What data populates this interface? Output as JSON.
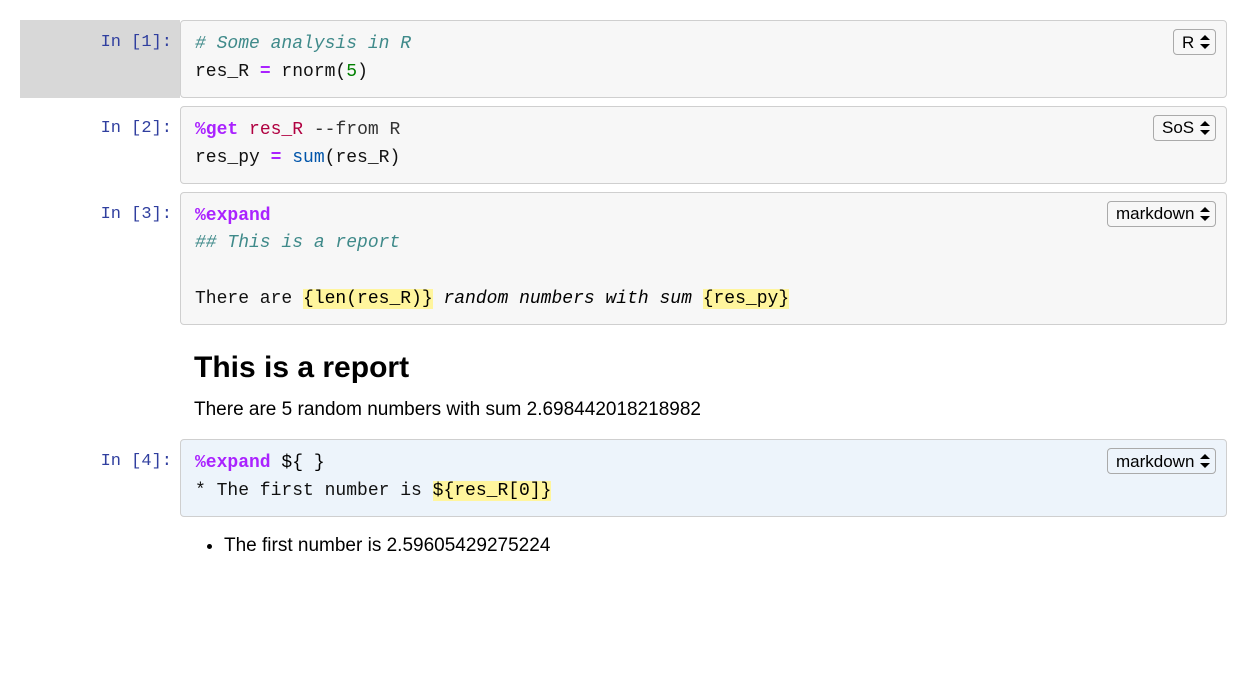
{
  "cells": [
    {
      "prompt": "In [1]:",
      "kernel": "R",
      "selected": true,
      "code": {
        "line1_comment": "# Some analysis in R",
        "line2_a": "res_R ",
        "line2_op": "=",
        "line2_b": " rnorm(",
        "line2_num": "5",
        "line2_c": ")"
      }
    },
    {
      "prompt": "In [2]:",
      "kernel": "SoS",
      "code": {
        "line1_magic": "%get",
        "line1_a": " ",
        "line1_arg": "res_R",
        "line1_b": " ",
        "line1_flag": "--from R",
        "line2_a": "res_py ",
        "line2_op": "=",
        "line2_b": " ",
        "line2_func": "sum",
        "line2_c": "(res_R)"
      }
    },
    {
      "prompt": "In [3]:",
      "kernel": "markdown",
      "code": {
        "line1_magic": "%expand",
        "line2_head": "## This is a report",
        "line4_a": "There are ",
        "line4_hl1": "{len(res_R)}",
        "line4_b": " random numbers with sum ",
        "line4_hl2": "{res_py}"
      },
      "output": {
        "heading": "This is a report",
        "para": "There are 5 random numbers with sum 2.698442018218982"
      }
    },
    {
      "prompt": "In [4]:",
      "kernel": "markdown",
      "blue": true,
      "code": {
        "line1_magic": "%expand",
        "line1_rest": " ${ }",
        "line2_a": "* The first number is ",
        "line2_hl": "${res_R[0]}"
      },
      "output": {
        "bullet": "The first number is 2.59605429275224"
      }
    }
  ],
  "kernel_options": [
    "R",
    "SoS",
    "markdown"
  ]
}
